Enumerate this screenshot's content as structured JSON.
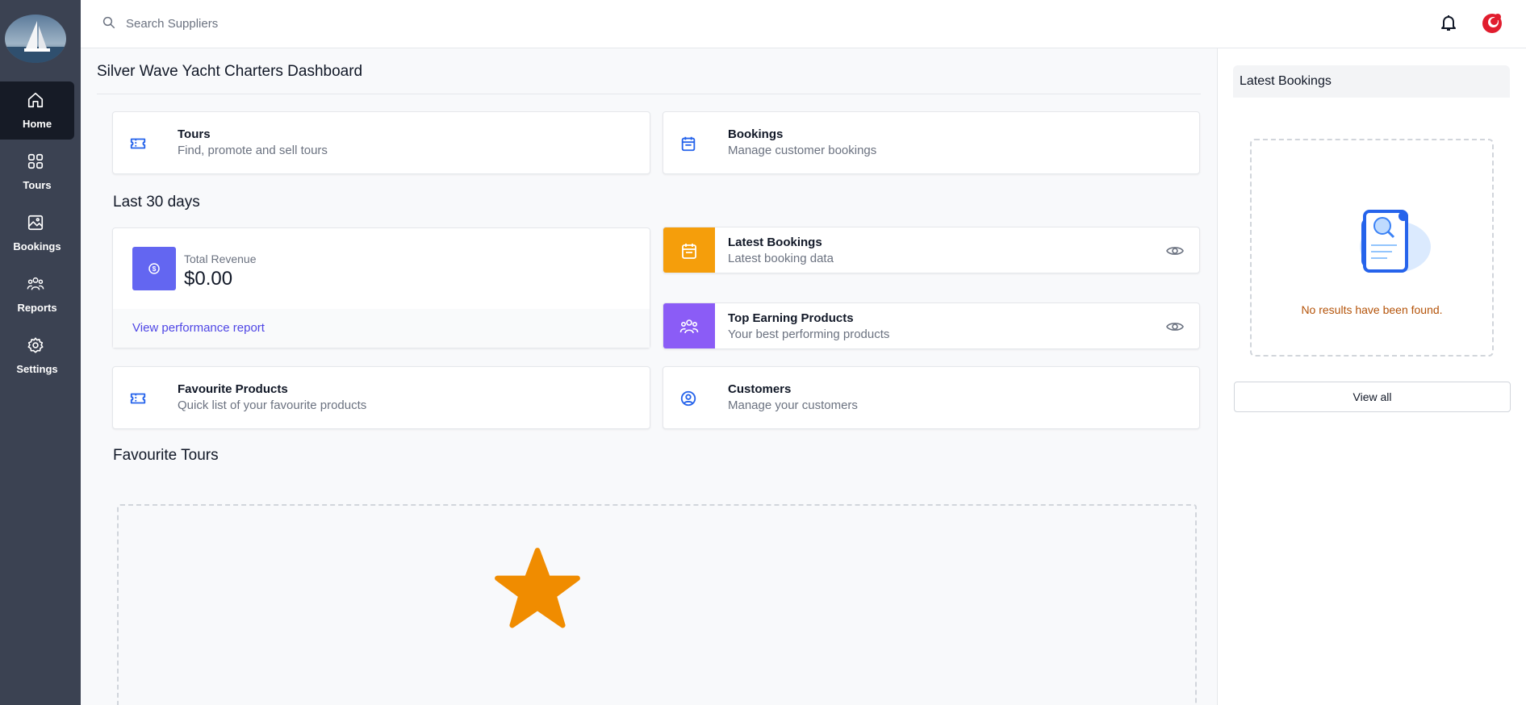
{
  "search": {
    "placeholder": "Search Suppliers"
  },
  "sidebar": {
    "items": [
      {
        "label": "Home",
        "icon": "home-icon"
      },
      {
        "label": "Tours",
        "icon": "grid-icon"
      },
      {
        "label": "Bookings",
        "icon": "image-icon"
      },
      {
        "label": "Reports",
        "icon": "users-icon"
      },
      {
        "label": "Settings",
        "icon": "gear-icon"
      }
    ]
  },
  "header": {
    "title": "Silver Wave Yacht Charters Dashboard"
  },
  "quick_links": [
    {
      "title": "Tours",
      "subtitle": "Find, promote and sell tours",
      "icon": "ticket-icon"
    },
    {
      "title": "Bookings",
      "subtitle": "Manage customer bookings",
      "icon": "calendar-icon"
    }
  ],
  "last30": {
    "title": "Last 30 days",
    "revenue_label": "Total Revenue",
    "revenue_value": "$0.00",
    "performance_link": "View performance report"
  },
  "stats": [
    {
      "title": "Latest Bookings",
      "subtitle": "Latest booking data",
      "icon": "calendar-icon",
      "color": "#f59e0b"
    },
    {
      "title": "Top Earning Products",
      "subtitle": "Your best performing products",
      "icon": "users-icon",
      "color": "#8b5cf6"
    }
  ],
  "bottom_links": [
    {
      "title": "Favourite Products",
      "subtitle": "Quick list of your favourite products",
      "icon": "ticket-icon"
    },
    {
      "title": "Customers",
      "subtitle": "Manage your customers",
      "icon": "user-circle-icon"
    }
  ],
  "favourite_tours": {
    "title": "Favourite Tours"
  },
  "right_panel": {
    "title": "Latest Bookings",
    "empty_text": "No results have been found.",
    "view_all": "View all"
  },
  "colors": {
    "sidebar": "#3b4252",
    "accent": "#6366f1",
    "star": "#f08c00",
    "link": "#4f46e5"
  }
}
